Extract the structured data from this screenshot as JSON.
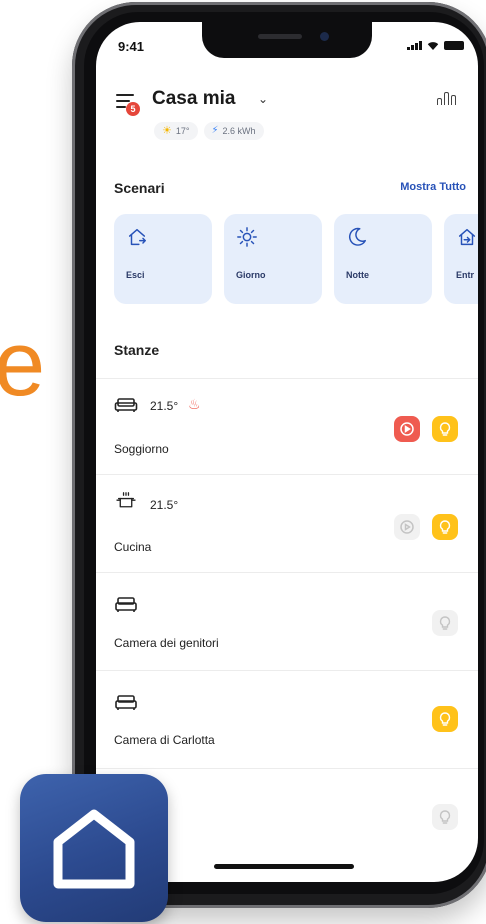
{
  "background_text": "e",
  "status_bar": {
    "time": "9:41"
  },
  "header": {
    "title": "Casa mia",
    "menu_badge": "5",
    "weather_chip": "17°",
    "energy_chip": "2.6 kWh"
  },
  "scenes": {
    "title": "Scenari",
    "show_all": "Mostra Tutto",
    "items": [
      {
        "label": "Esci",
        "icon": "exit-home-icon"
      },
      {
        "label": "Giorno",
        "icon": "sun-icon"
      },
      {
        "label": "Notte",
        "icon": "moon-icon"
      },
      {
        "label": "Entr",
        "icon": "enter-home-icon"
      }
    ]
  },
  "rooms": {
    "title": "Stanze",
    "items": [
      {
        "name": "Soggiorno",
        "temperature": "21.5°",
        "icon": "sofa-icon",
        "heating": true,
        "music": "active",
        "light": "on"
      },
      {
        "name": "Cucina",
        "temperature": "21.5°",
        "icon": "cooking-pot-icon",
        "heating": false,
        "music": "inactive",
        "light": "on"
      },
      {
        "name": "Camera dei genitori",
        "temperature": "",
        "icon": "bed-icon",
        "heating": false,
        "light": "off"
      },
      {
        "name": "Camera di Carlotta",
        "temperature": "",
        "icon": "bed-icon",
        "heating": false,
        "light": "on"
      },
      {
        "name": "",
        "temperature": "",
        "icon": "",
        "heating": false,
        "light": "off"
      }
    ]
  },
  "colors": {
    "accent_blue": "#2752b8",
    "scene_bg": "#e6eefb",
    "music_active": "#ef5b50",
    "light_on": "#ffc21a",
    "app_icon": "#2c4a8f",
    "background_letter": "#f08a24"
  }
}
